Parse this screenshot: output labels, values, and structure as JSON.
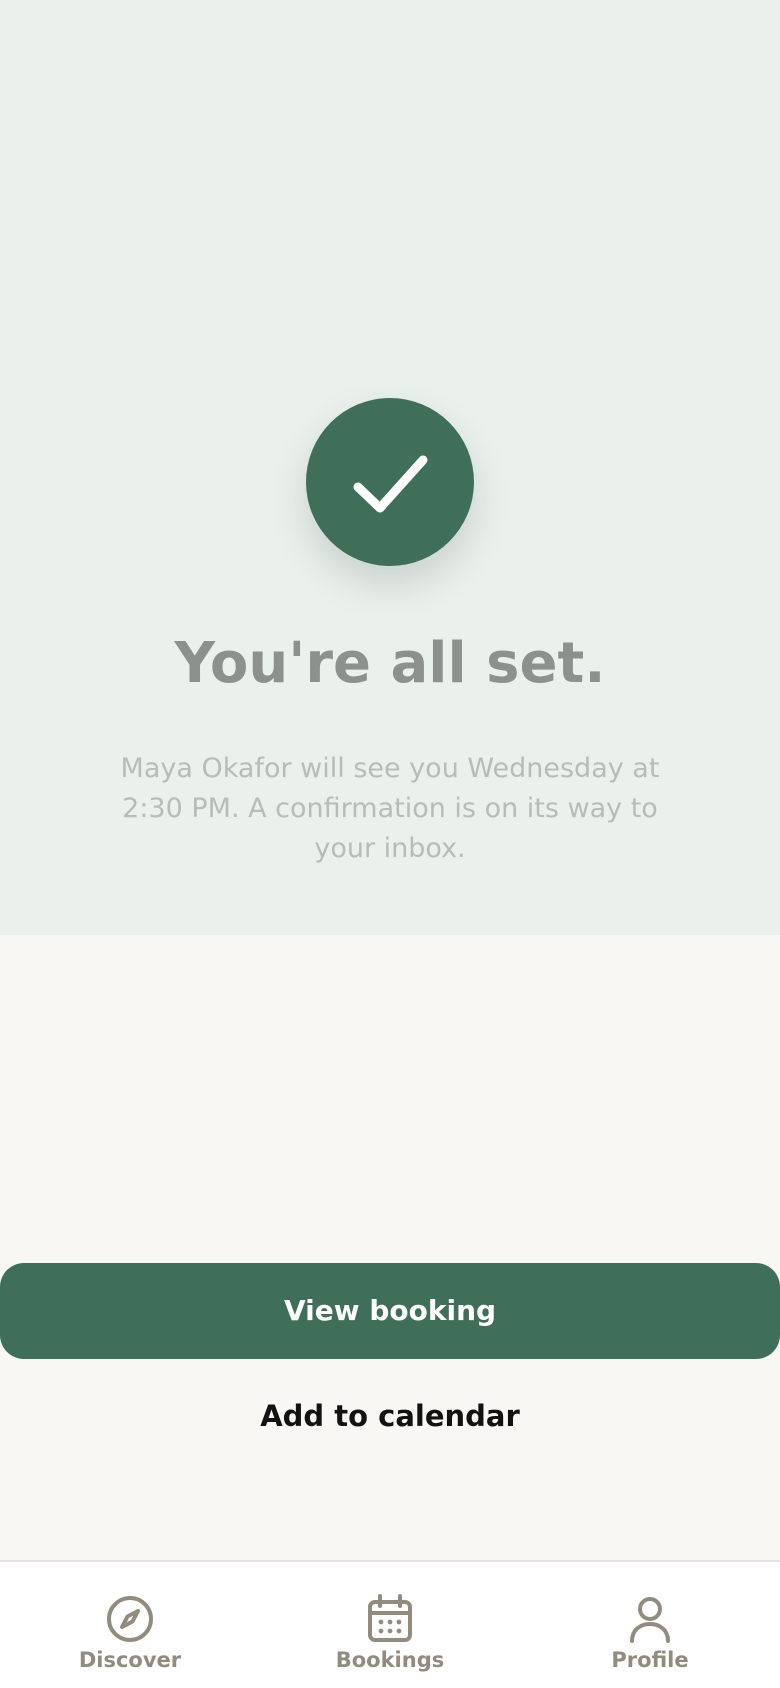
{
  "confirmation": {
    "icon": "check-icon",
    "title": "You're all set.",
    "message": "Maya Okafor will see you Wednesday at 2:30 PM. A confirmation is on its way to your inbox."
  },
  "actions": {
    "primary_label": "View booking",
    "secondary_label": "Add to calendar"
  },
  "tabbar": {
    "items": [
      {
        "label": "Discover",
        "icon": "compass-icon"
      },
      {
        "label": "Bookings",
        "icon": "calendar-icon"
      },
      {
        "label": "Profile",
        "icon": "user-icon"
      }
    ]
  },
  "colors": {
    "accent": "#3f6f59",
    "hero_background": "#eaf0ec",
    "page_background": "#f8f7f3",
    "muted_text": "#8d918b",
    "tab_text": "#928b80"
  }
}
